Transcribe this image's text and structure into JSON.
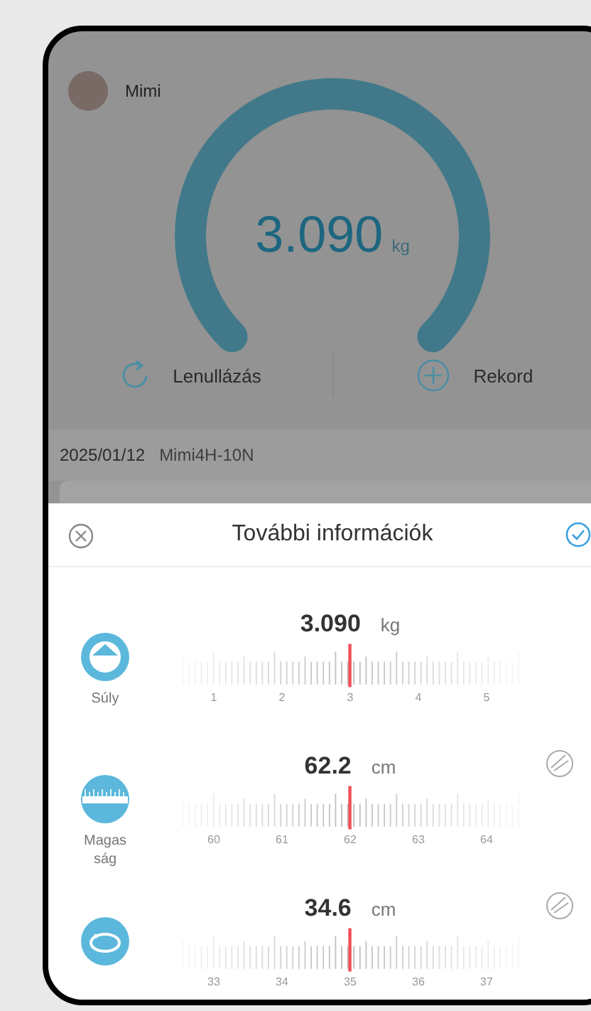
{
  "profile": {
    "name": "Mimi"
  },
  "gauge": {
    "value": "3.090",
    "unit": "kg"
  },
  "actions": [
    {
      "kind": "reset",
      "label": "Lenullázás"
    },
    {
      "kind": "add",
      "label": "Rekord"
    }
  ],
  "record": {
    "date": "2025/01/12",
    "device": "Mimi4H-10N"
  },
  "sheet": {
    "title": "További információk",
    "rows": [
      {
        "kind": "weight",
        "label": "Súly",
        "value": "3.090",
        "unit": "kg",
        "clearable": false,
        "ticks": [
          "1",
          "2",
          "3",
          "4",
          "5"
        ]
      },
      {
        "kind": "height",
        "label": "Magasság",
        "value": "62.2",
        "unit": "cm",
        "clearable": true,
        "ticks": [
          "60",
          "61",
          "62",
          "63",
          "64"
        ]
      },
      {
        "kind": "circumference",
        "value": "34.6",
        "unit": "cm",
        "clearable": true,
        "ticks": [
          "33",
          "34",
          "35",
          "36",
          "37"
        ]
      }
    ]
  }
}
